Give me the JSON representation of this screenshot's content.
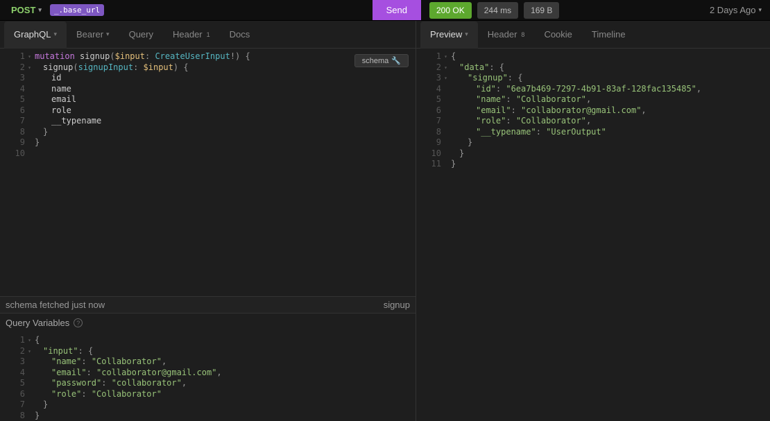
{
  "topbar": {
    "method": "POST",
    "url_var": "_.base_url",
    "send_label": "Send",
    "status_code": "200",
    "status_text": "OK",
    "time": "244 ms",
    "size": "169 B",
    "timestamp": "2 Days Ago"
  },
  "left_tabs": {
    "graphql": "GraphQL",
    "bearer": "Bearer",
    "query": "Query",
    "header": "Header",
    "header_badge": "1",
    "docs": "Docs"
  },
  "right_tabs": {
    "preview": "Preview",
    "header": "Header",
    "header_badge": "8",
    "cookie": "Cookie",
    "timeline": "Timeline"
  },
  "schema_btn": "schema",
  "statusbar": {
    "left": "schema fetched just now",
    "right": "signup"
  },
  "qv_header": "Query Variables",
  "request_code": {
    "l1_kw": "mutation",
    "l1_fn": "signup",
    "l1_var": "$input",
    "l1_type": "CreateUserInput",
    "l2_fn": "signup",
    "l2_arg": "signupInput",
    "l2_var": "$input",
    "l3": "id",
    "l4": "name",
    "l5": "email",
    "l6": "role",
    "l7": "__typename"
  },
  "response_code": {
    "data_key": "\"data\"",
    "signup_key": "\"signup\"",
    "id_key": "\"id\"",
    "id_val": "\"6ea7b469-7297-4b91-83af-128fac135485\"",
    "name_key": "\"name\"",
    "name_val": "\"Collaborator\"",
    "email_key": "\"email\"",
    "email_val": "\"collaborator@gmail.com\"",
    "role_key": "\"role\"",
    "role_val": "\"Collaborator\"",
    "tn_key": "\"__typename\"",
    "tn_val": "\"UserOutput\""
  },
  "qv_code": {
    "input_key": "\"input\"",
    "name_key": "\"name\"",
    "name_val": "\"Collaborator\"",
    "email_key": "\"email\"",
    "email_val": "\"collaborator@gmail.com\"",
    "password_key": "\"password\"",
    "password_val": "\"collaborator\"",
    "role_key": "\"role\"",
    "role_val": "\"Collaborator\""
  }
}
